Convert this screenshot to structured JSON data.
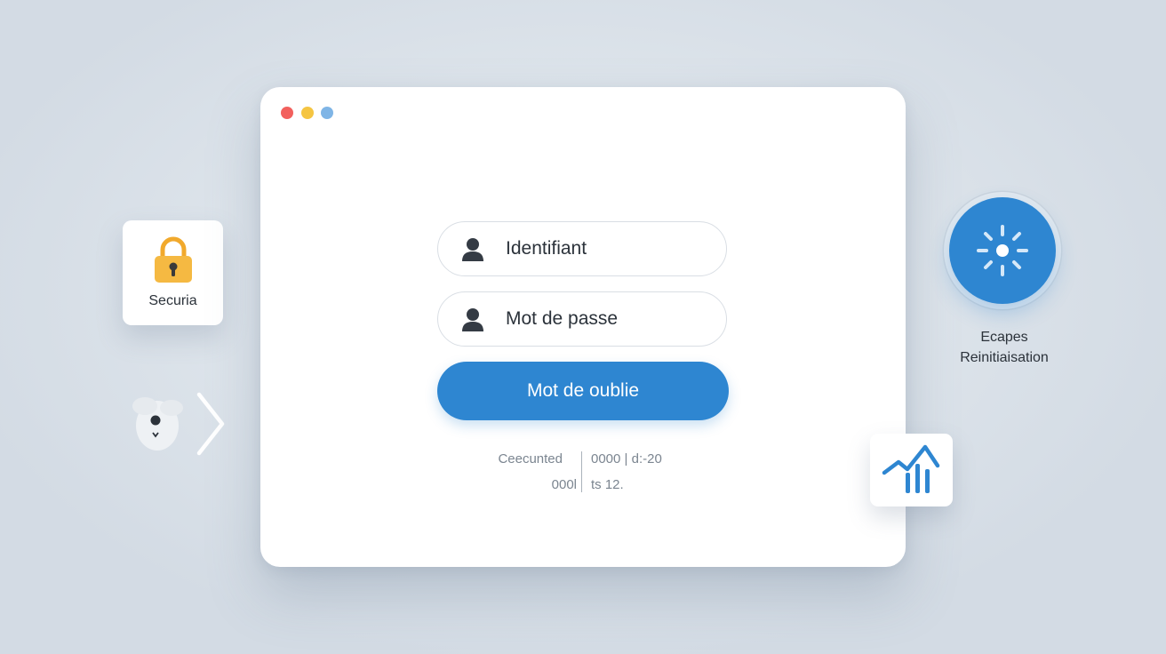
{
  "window": {
    "controls": [
      "close",
      "minimize",
      "maximize"
    ],
    "control_colors": {
      "close": "#f2605d",
      "minimize": "#f5c542",
      "maximize": "#7fb5e6"
    }
  },
  "login": {
    "username_placeholder": "Identifiant",
    "password_placeholder": "Mot de passe",
    "submit_label": "Mot de oublie"
  },
  "meta": {
    "left_line1": "Ceecunted",
    "left_line2": "000l",
    "right_line1": "0000 | d:-20",
    "right_line2": "ts 12."
  },
  "security_card": {
    "label": "Securia",
    "icon": "padlock-icon"
  },
  "steps_badge": {
    "line1": "Ecapes",
    "line2": "Reinitiaisation",
    "icon": "loading-spinner-icon"
  },
  "side_icons": [
    "ghost-face-icon",
    "chevron-right-icon",
    "signal-chart-icon"
  ],
  "colors": {
    "accent": "#2e86d1",
    "lock": "#f5b942",
    "background": "#d6dee7",
    "text": "#2b323a"
  }
}
